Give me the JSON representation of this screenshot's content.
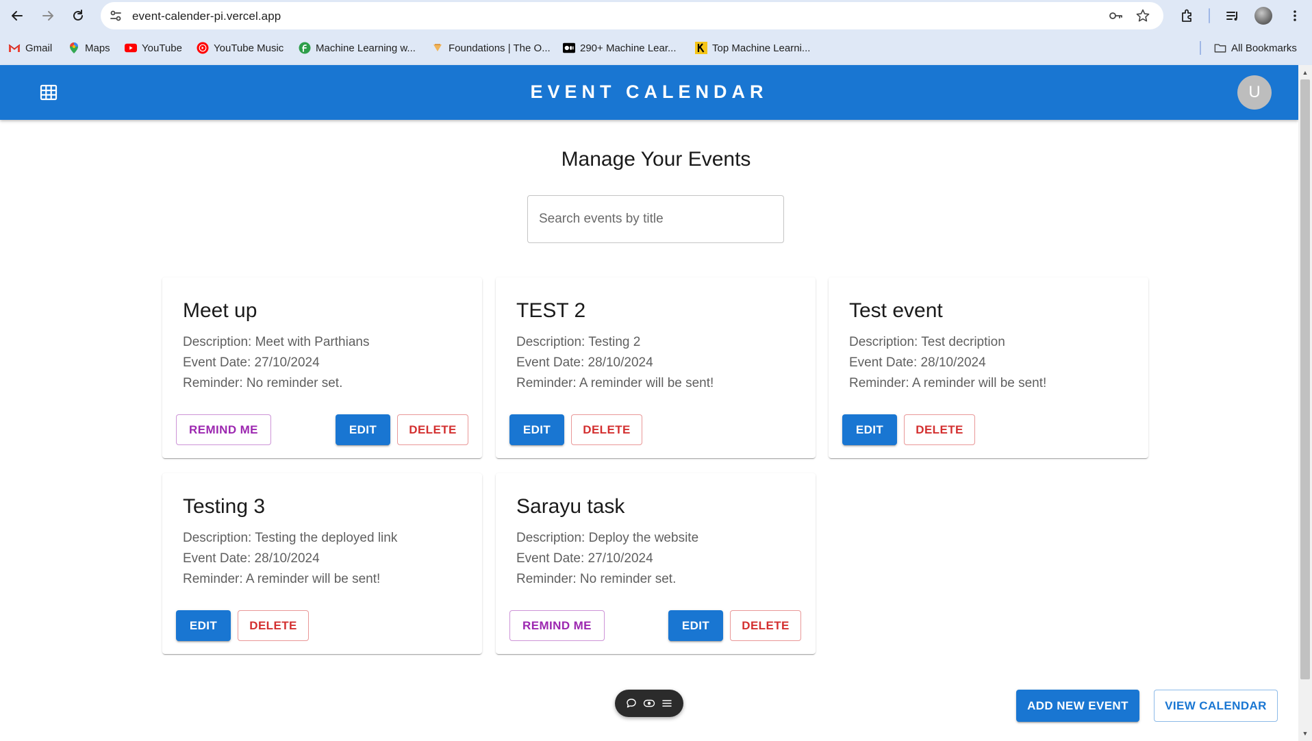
{
  "browser": {
    "url": "event-calender-pi.vercel.app",
    "bookmarks": [
      {
        "label": "Gmail",
        "icon": "gmail-icon"
      },
      {
        "label": "Maps",
        "icon": "maps-icon"
      },
      {
        "label": "YouTube",
        "icon": "youtube-icon"
      },
      {
        "label": "YouTube Music",
        "icon": "youtube-music-icon"
      },
      {
        "label": "Machine Learning w...",
        "icon": "ml-site-icon"
      },
      {
        "label": "Foundations | The O...",
        "icon": "foundations-icon"
      },
      {
        "label": "290+ Machine Lear...",
        "icon": "medium-icon"
      },
      {
        "label": "Top Machine Learni...",
        "icon": "kaggle-k-icon"
      }
    ],
    "all_bookmarks_label": "All Bookmarks"
  },
  "appbar": {
    "title": "EVENT CALENDAR",
    "avatar_letter": "U"
  },
  "main": {
    "heading": "Manage Your Events",
    "search_placeholder": "Search events by title"
  },
  "events": [
    {
      "title": "Meet up",
      "description": "Description: Meet with Parthians",
      "date": "Event Date: 27/10/2024",
      "reminder": "Reminder: No reminder set.",
      "has_remind_button": true
    },
    {
      "title": "TEST 2",
      "description": "Description: Testing 2",
      "date": "Event Date: 28/10/2024",
      "reminder": "Reminder: A reminder will be sent!",
      "has_remind_button": false
    },
    {
      "title": "Test event",
      "description": "Description: Test decription",
      "date": "Event Date: 28/10/2024",
      "reminder": "Reminder: A reminder will be sent!",
      "has_remind_button": false
    },
    {
      "title": "Testing 3",
      "description": "Description: Testing the deployed link",
      "date": "Event Date: 28/10/2024",
      "reminder": "Reminder: A reminder will be sent!",
      "has_remind_button": false
    },
    {
      "title": "Sarayu task",
      "description": "Description: Deploy the website",
      "date": "Event Date: 27/10/2024",
      "reminder": "Reminder: No reminder set.",
      "has_remind_button": true
    }
  ],
  "buttons": {
    "remind": "REMIND ME",
    "edit": "EDIT",
    "delete": "DELETE",
    "add_new_event": "ADD NEW EVENT",
    "view_calendar": "VIEW CALENDAR"
  },
  "colors": {
    "primary": "#1976d2",
    "error": "#d32f2f",
    "secondary": "#9c27b0"
  }
}
